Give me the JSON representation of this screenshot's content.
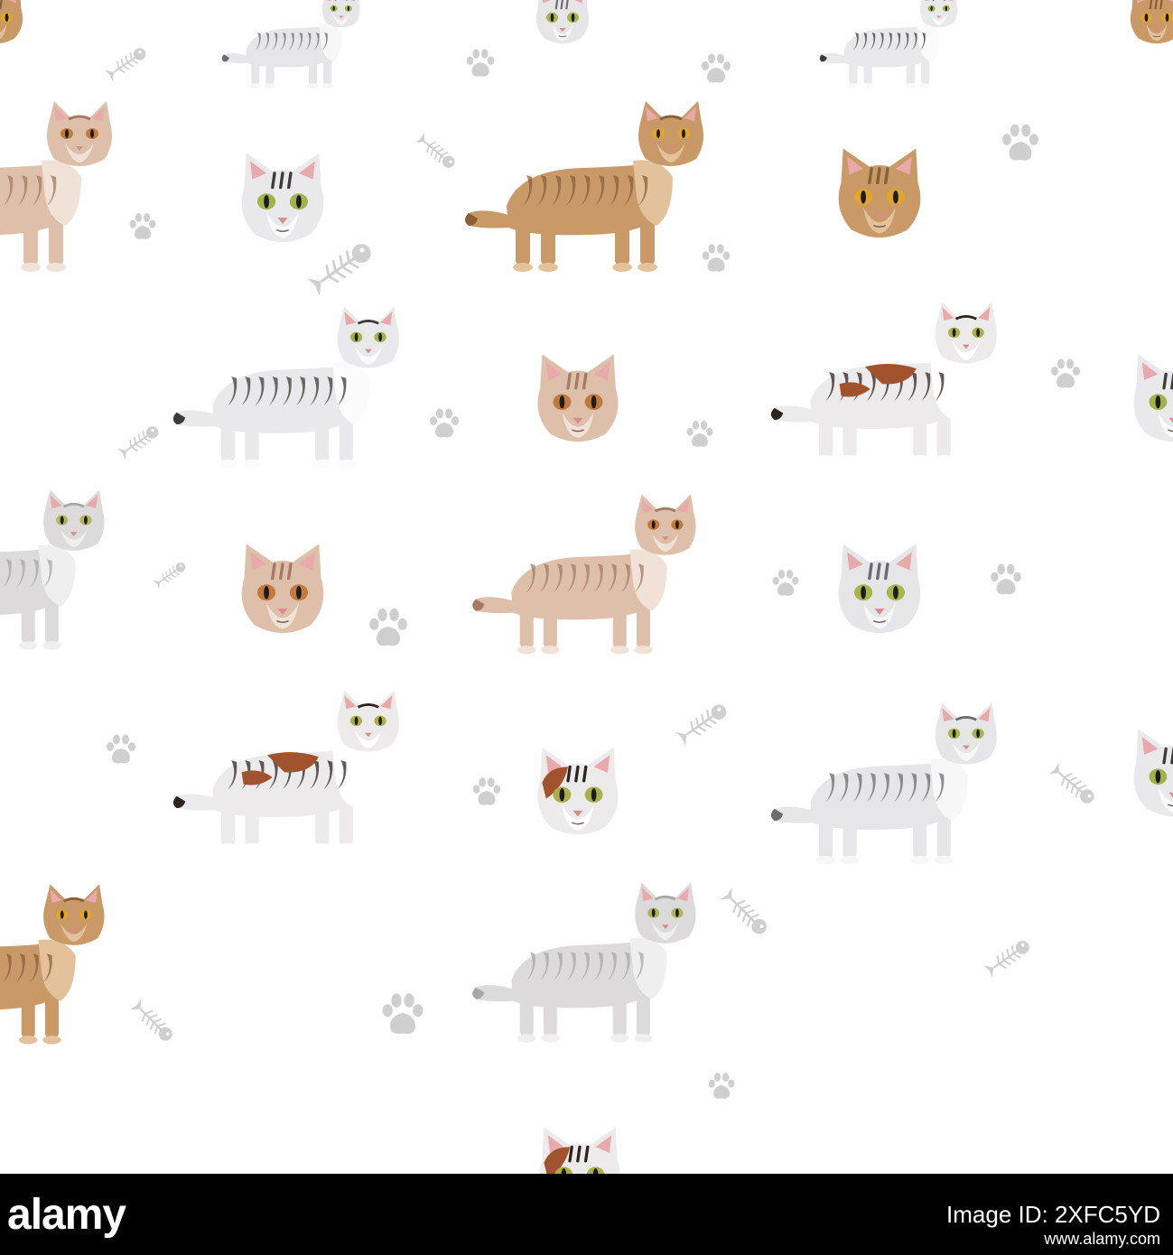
{
  "palette": {
    "silver": {
      "base": "#e6e6e8",
      "dark": "#6c6c70",
      "light": "#f7f7f8",
      "eye": "#a7b54a"
    },
    "blacktabby": {
      "base": "#e9e9ec",
      "dark": "#3e3b3a",
      "light": "#fbfbfb",
      "eye": "#a3b34a"
    },
    "cinnamon": {
      "base": "#c99968",
      "dark": "#8a5f35",
      "light": "#e3c29b",
      "eye": "#e0a52a"
    },
    "cream": {
      "base": "#ddbfaa",
      "dark": "#a67a63",
      "light": "#f0e2d6",
      "eye": "#c27a3b"
    },
    "tortie": {
      "base": "#eceaea",
      "dark": "#2d2422",
      "light": "#ffffff",
      "accent": "#a0532c",
      "eye": "#a9b049"
    },
    "lightsilver": {
      "base": "#dcdadb",
      "dark": "#a8a6a7",
      "light": "#efefef",
      "eye": "#b1b55a"
    },
    "motif": "#cfcfcf"
  },
  "tiles": [
    {
      "kind": "body",
      "coat": "silver"
    },
    {
      "kind": "body",
      "coat": "blacktabby"
    },
    {
      "kind": "body",
      "coat": "cream"
    },
    {
      "kind": "body",
      "coat": "cinnamon"
    },
    {
      "kind": "body",
      "coat": "blacktabby"
    },
    {
      "kind": "body",
      "coat": "tortie"
    },
    {
      "kind": "body",
      "coat": "lightsilver"
    },
    {
      "kind": "body",
      "coat": "cream"
    },
    {
      "kind": "body",
      "coat": "tortie"
    },
    {
      "kind": "body",
      "coat": "silver"
    },
    {
      "kind": "body",
      "coat": "cinnamon"
    },
    {
      "kind": "body",
      "coat": "lightsilver"
    },
    {
      "kind": "head",
      "coat": "cinnamon"
    },
    {
      "kind": "head",
      "coat": "silver"
    },
    {
      "kind": "head",
      "coat": "cinnamon"
    },
    {
      "kind": "head",
      "coat": "blacktabby"
    },
    {
      "kind": "head",
      "coat": "cinnamon"
    },
    {
      "kind": "head",
      "coat": "cream"
    },
    {
      "kind": "head",
      "coat": "blacktabby"
    },
    {
      "kind": "head",
      "coat": "cream"
    },
    {
      "kind": "head",
      "coat": "silver"
    },
    {
      "kind": "head",
      "coat": "tortie"
    },
    {
      "kind": "head",
      "coat": "blacktabby"
    },
    {
      "kind": "head",
      "coat": "tortie"
    },
    {
      "kind": "paw"
    },
    {
      "kind": "paw"
    },
    {
      "kind": "paw"
    },
    {
      "kind": "paw"
    },
    {
      "kind": "paw"
    },
    {
      "kind": "paw"
    },
    {
      "kind": "paw"
    },
    {
      "kind": "paw"
    },
    {
      "kind": "paw"
    },
    {
      "kind": "paw"
    },
    {
      "kind": "paw"
    },
    {
      "kind": "paw"
    },
    {
      "kind": "paw"
    },
    {
      "kind": "paw"
    },
    {
      "kind": "paw"
    },
    {
      "kind": "fish"
    },
    {
      "kind": "fish"
    },
    {
      "kind": "fish"
    },
    {
      "kind": "fish"
    },
    {
      "kind": "fish"
    },
    {
      "kind": "fish"
    },
    {
      "kind": "fish"
    },
    {
      "kind": "fish"
    },
    {
      "kind": "fish"
    },
    {
      "kind": "fish"
    }
  ],
  "banner": {
    "logo": "alamy",
    "image_id": "Image ID: 2XFC5YD",
    "url": "www.alamy.com"
  }
}
